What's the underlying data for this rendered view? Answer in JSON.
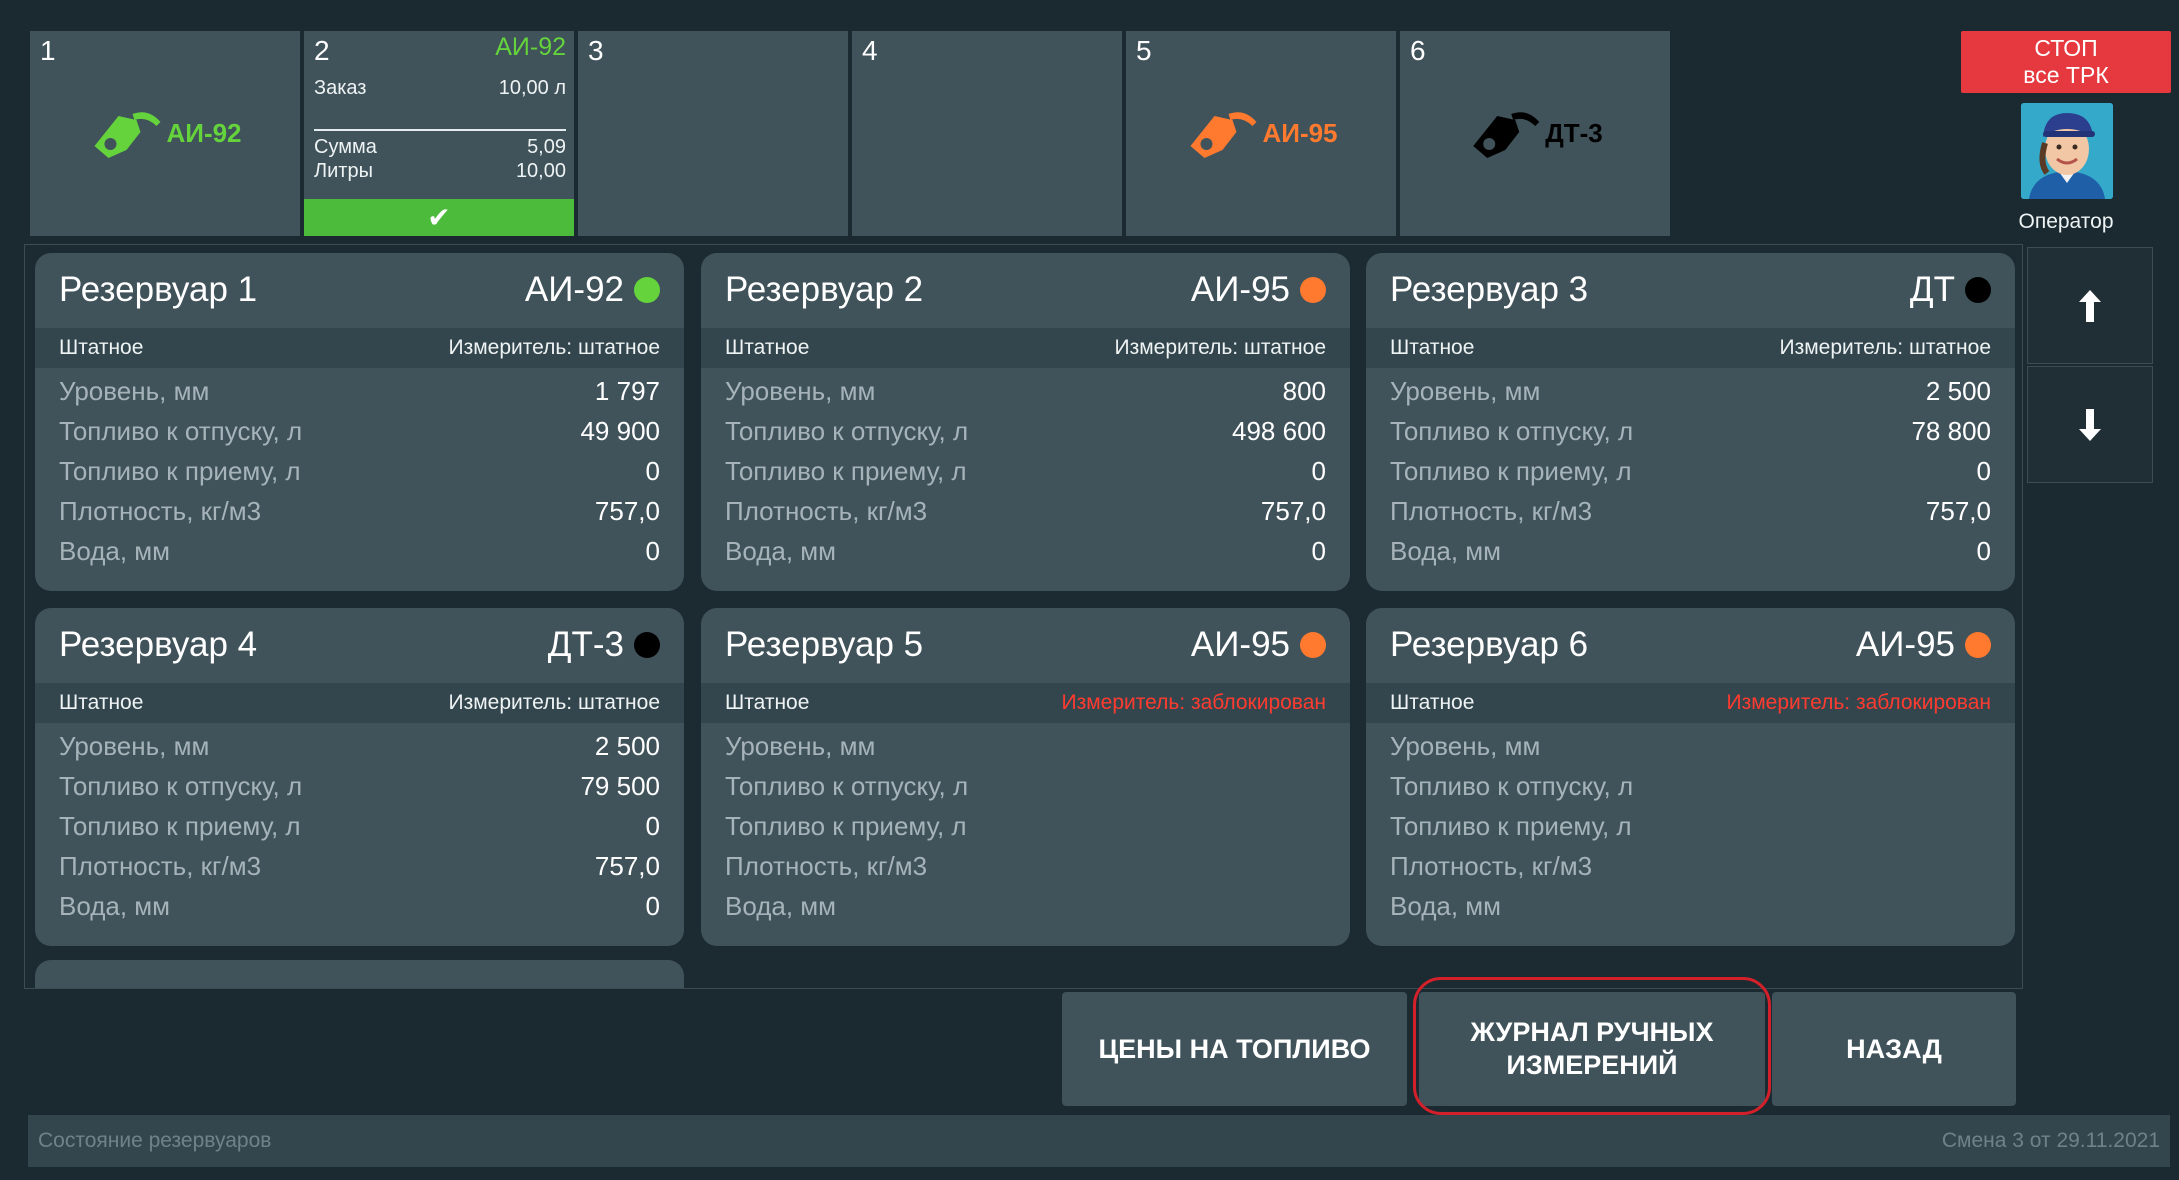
{
  "colors": {
    "ai92": "#64d33c",
    "ai95": "#ff7a2e",
    "dt": "#000000",
    "confirm": "#4cba3a",
    "stop": "#e5393f",
    "blocked": "#ff3b30"
  },
  "pumps": [
    {
      "number": "1",
      "fuel_label": "АИ-92",
      "icon": "fuel-nozzle-icon"
    },
    {
      "number": "2",
      "fuel_label": "АИ-92",
      "order": {
        "label": "Заказ",
        "value": "10,00 л",
        "sum_label": "Сумма",
        "sum_value": "5,09",
        "liters_label": "Литры",
        "liters_value": "10,00",
        "confirm_icon": "✔"
      }
    },
    {
      "number": "3"
    },
    {
      "number": "4"
    },
    {
      "number": "5",
      "fuel_label": "АИ-95",
      "icon": "fuel-nozzle-icon"
    },
    {
      "number": "6",
      "fuel_label": "ДТ-3",
      "icon": "fuel-nozzle-icon"
    }
  ],
  "stop_button": {
    "line1": "СТОП",
    "line2": "все ТРК"
  },
  "operator": {
    "label": "Оператор",
    "avatar": "operator-avatar"
  },
  "tank_labels": {
    "mode": "Штатное",
    "level": "Уровень, мм",
    "release": "Топливо к отпуску, л",
    "intake": "Топливо к приему, л",
    "density": "Плотность, кг/м3",
    "water": "Вода, мм"
  },
  "tanks": [
    {
      "title": "Резервуар 1",
      "fuel": "АИ-92",
      "dot": "#64d33c",
      "meter": "Измеритель: штатное",
      "blocked": false,
      "level": "1 797",
      "release": "49 900",
      "intake": "0",
      "density": "757,0",
      "water": "0"
    },
    {
      "title": "Резервуар 2",
      "fuel": "АИ-95",
      "dot": "#ff7a2e",
      "meter": "Измеритель: штатное",
      "blocked": false,
      "level": "800",
      "release": "498 600",
      "intake": "0",
      "density": "757,0",
      "water": "0"
    },
    {
      "title": "Резервуар 3",
      "fuel": "ДТ",
      "dot": "#000000",
      "meter": "Измеритель: штатное",
      "blocked": false,
      "level": "2 500",
      "release": "78 800",
      "intake": "0",
      "density": "757,0",
      "water": "0"
    },
    {
      "title": "Резервуар 4",
      "fuel": "ДТ-3",
      "dot": "#000000",
      "meter": "Измеритель: штатное",
      "blocked": false,
      "level": "2 500",
      "release": "79 500",
      "intake": "0",
      "density": "757,0",
      "water": "0"
    },
    {
      "title": "Резервуар 5",
      "fuel": "АИ-95",
      "dot": "#ff7a2e",
      "meter": "Измеритель: заблокирован",
      "blocked": true,
      "level": "",
      "release": "",
      "intake": "",
      "density": "",
      "water": ""
    },
    {
      "title": "Резервуар 6",
      "fuel": "АИ-95",
      "dot": "#ff7a2e",
      "meter": "Измеритель: заблокирован",
      "blocked": true,
      "level": "",
      "release": "",
      "intake": "",
      "density": "",
      "water": ""
    }
  ],
  "scroll": {
    "up_icon": "arrow-up-icon",
    "down_icon": "arrow-down-icon"
  },
  "actions": {
    "prices": "ЦЕНЫ НА ТОПЛИВО",
    "journal_line1": "ЖУРНАЛ РУЧНЫХ",
    "journal_line2": "ИЗМЕРЕНИЙ",
    "back": "НАЗАД"
  },
  "status": {
    "left": "Состояние резервуаров",
    "right": "Смена 3 от 29.11.2021"
  }
}
